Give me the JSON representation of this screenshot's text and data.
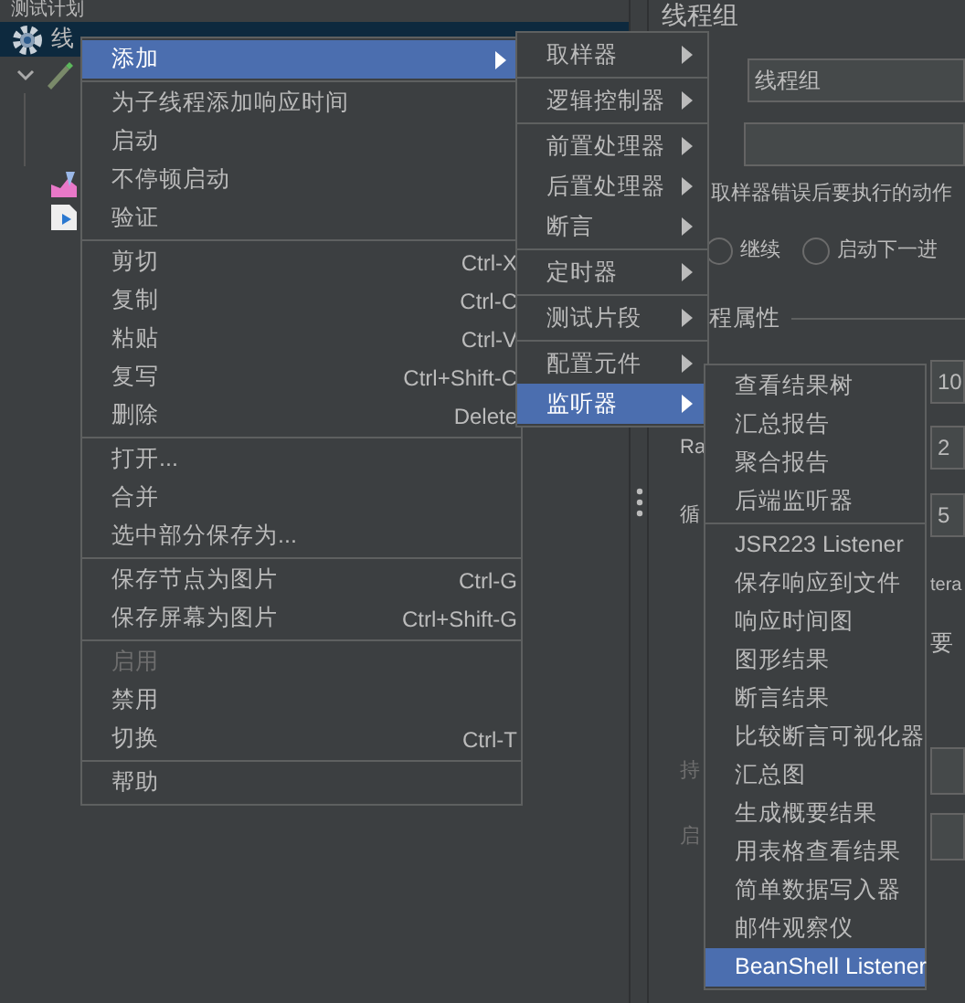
{
  "tree": {
    "items": [
      {
        "label": "测试计划",
        "selected": false
      },
      {
        "label": "线",
        "selected": true
      }
    ]
  },
  "panel": {
    "title": "线程组",
    "name_value": "线程组",
    "error_action_label": "取样器错误后要执行的动作",
    "radios": [
      {
        "label": "继续",
        "selected": false
      },
      {
        "label": "启动下一进",
        "selected": false
      }
    ],
    "section_title": "程属性",
    "fields": [
      {
        "value": "10"
      },
      {
        "label": "Ra",
        "value": "2"
      },
      {
        "label": "循",
        "value": "5"
      }
    ],
    "fragments": [
      "tera",
      "要"
    ],
    "disabled_fields": [
      {
        "label": "持",
        "disabled": true
      },
      {
        "label": "启",
        "disabled": true
      }
    ]
  },
  "context_menu": {
    "items": [
      {
        "kind": "item",
        "label": "添加",
        "selected": true,
        "disabled": false,
        "has_submenu": true
      },
      {
        "kind": "separator"
      },
      {
        "kind": "item",
        "label": "为子线程添加响应时间",
        "selected": false,
        "disabled": false,
        "has_submenu": false
      },
      {
        "kind": "item",
        "label": "启动",
        "selected": false,
        "disabled": false,
        "has_submenu": false
      },
      {
        "kind": "item",
        "label": "不停顿启动",
        "selected": false,
        "disabled": false,
        "has_submenu": false
      },
      {
        "kind": "item",
        "label": "验证",
        "selected": false,
        "disabled": false,
        "has_submenu": false
      },
      {
        "kind": "separator"
      },
      {
        "kind": "item",
        "label": "剪切",
        "shortcut": "Ctrl-X",
        "selected": false,
        "disabled": false,
        "has_submenu": false
      },
      {
        "kind": "item",
        "label": "复制",
        "shortcut": "Ctrl-C",
        "selected": false,
        "disabled": false,
        "has_submenu": false
      },
      {
        "kind": "item",
        "label": "粘贴",
        "shortcut": "Ctrl-V",
        "selected": false,
        "disabled": false,
        "has_submenu": false
      },
      {
        "kind": "item",
        "label": "复写",
        "shortcut": "Ctrl+Shift-C",
        "selected": false,
        "disabled": false,
        "has_submenu": false
      },
      {
        "kind": "item",
        "label": "删除",
        "shortcut": "Delete",
        "selected": false,
        "disabled": false,
        "has_submenu": false
      },
      {
        "kind": "separator"
      },
      {
        "kind": "item",
        "label": "打开...",
        "selected": false,
        "disabled": false,
        "has_submenu": false
      },
      {
        "kind": "item",
        "label": "合并",
        "selected": false,
        "disabled": false,
        "has_submenu": false
      },
      {
        "kind": "item",
        "label": "选中部分保存为...",
        "selected": false,
        "disabled": false,
        "has_submenu": false
      },
      {
        "kind": "separator"
      },
      {
        "kind": "item",
        "label": "保存节点为图片",
        "shortcut": "Ctrl-G",
        "selected": false,
        "disabled": false,
        "has_submenu": false
      },
      {
        "kind": "item",
        "label": "保存屏幕为图片",
        "shortcut": "Ctrl+Shift-G",
        "selected": false,
        "disabled": false,
        "has_submenu": false
      },
      {
        "kind": "separator"
      },
      {
        "kind": "item",
        "label": "启用",
        "selected": false,
        "disabled": true,
        "has_submenu": false
      },
      {
        "kind": "item",
        "label": "禁用",
        "selected": false,
        "disabled": false,
        "has_submenu": false
      },
      {
        "kind": "item",
        "label": "切换",
        "shortcut": "Ctrl-T",
        "selected": false,
        "disabled": false,
        "has_submenu": false
      },
      {
        "kind": "separator"
      },
      {
        "kind": "item",
        "label": "帮助",
        "selected": false,
        "disabled": false,
        "has_submenu": false
      }
    ]
  },
  "add_submenu": {
    "items": [
      {
        "kind": "item",
        "label": "取样器",
        "selected": false,
        "has_submenu": true
      },
      {
        "kind": "separator"
      },
      {
        "kind": "item",
        "label": "逻辑控制器",
        "selected": false,
        "has_submenu": true
      },
      {
        "kind": "separator"
      },
      {
        "kind": "item",
        "label": "前置处理器",
        "selected": false,
        "has_submenu": true
      },
      {
        "kind": "item",
        "label": "后置处理器",
        "selected": false,
        "has_submenu": true
      },
      {
        "kind": "item",
        "label": "断言",
        "selected": false,
        "has_submenu": true
      },
      {
        "kind": "separator"
      },
      {
        "kind": "item",
        "label": "定时器",
        "selected": false,
        "has_submenu": true
      },
      {
        "kind": "separator"
      },
      {
        "kind": "item",
        "label": "测试片段",
        "selected": false,
        "has_submenu": true
      },
      {
        "kind": "separator"
      },
      {
        "kind": "item",
        "label": "配置元件",
        "selected": false,
        "has_submenu": true
      },
      {
        "kind": "item",
        "label": "监听器",
        "selected": true,
        "has_submenu": true
      }
    ]
  },
  "listener_submenu": {
    "items": [
      {
        "kind": "item",
        "label": "查看结果树",
        "selected": false
      },
      {
        "kind": "item",
        "label": "汇总报告",
        "selected": false
      },
      {
        "kind": "item",
        "label": "聚合报告",
        "selected": false
      },
      {
        "kind": "item",
        "label": "后端监听器",
        "selected": false
      },
      {
        "kind": "separator"
      },
      {
        "kind": "item",
        "label": "JSR223 Listener",
        "selected": false
      },
      {
        "kind": "item",
        "label": "保存响应到文件",
        "selected": false
      },
      {
        "kind": "item",
        "label": "响应时间图",
        "selected": false
      },
      {
        "kind": "item",
        "label": "图形结果",
        "selected": false
      },
      {
        "kind": "item",
        "label": "断言结果",
        "selected": false
      },
      {
        "kind": "item",
        "label": "比较断言可视化器",
        "selected": false
      },
      {
        "kind": "item",
        "label": "汇总图",
        "selected": false
      },
      {
        "kind": "item",
        "label": "生成概要结果",
        "selected": false
      },
      {
        "kind": "item",
        "label": "用表格查看结果",
        "selected": false
      },
      {
        "kind": "item",
        "label": "简单数据写入器",
        "selected": false
      },
      {
        "kind": "item",
        "label": "邮件观察仪",
        "selected": false
      },
      {
        "kind": "item",
        "label": "BeanShell Listener",
        "selected": true
      }
    ]
  }
}
